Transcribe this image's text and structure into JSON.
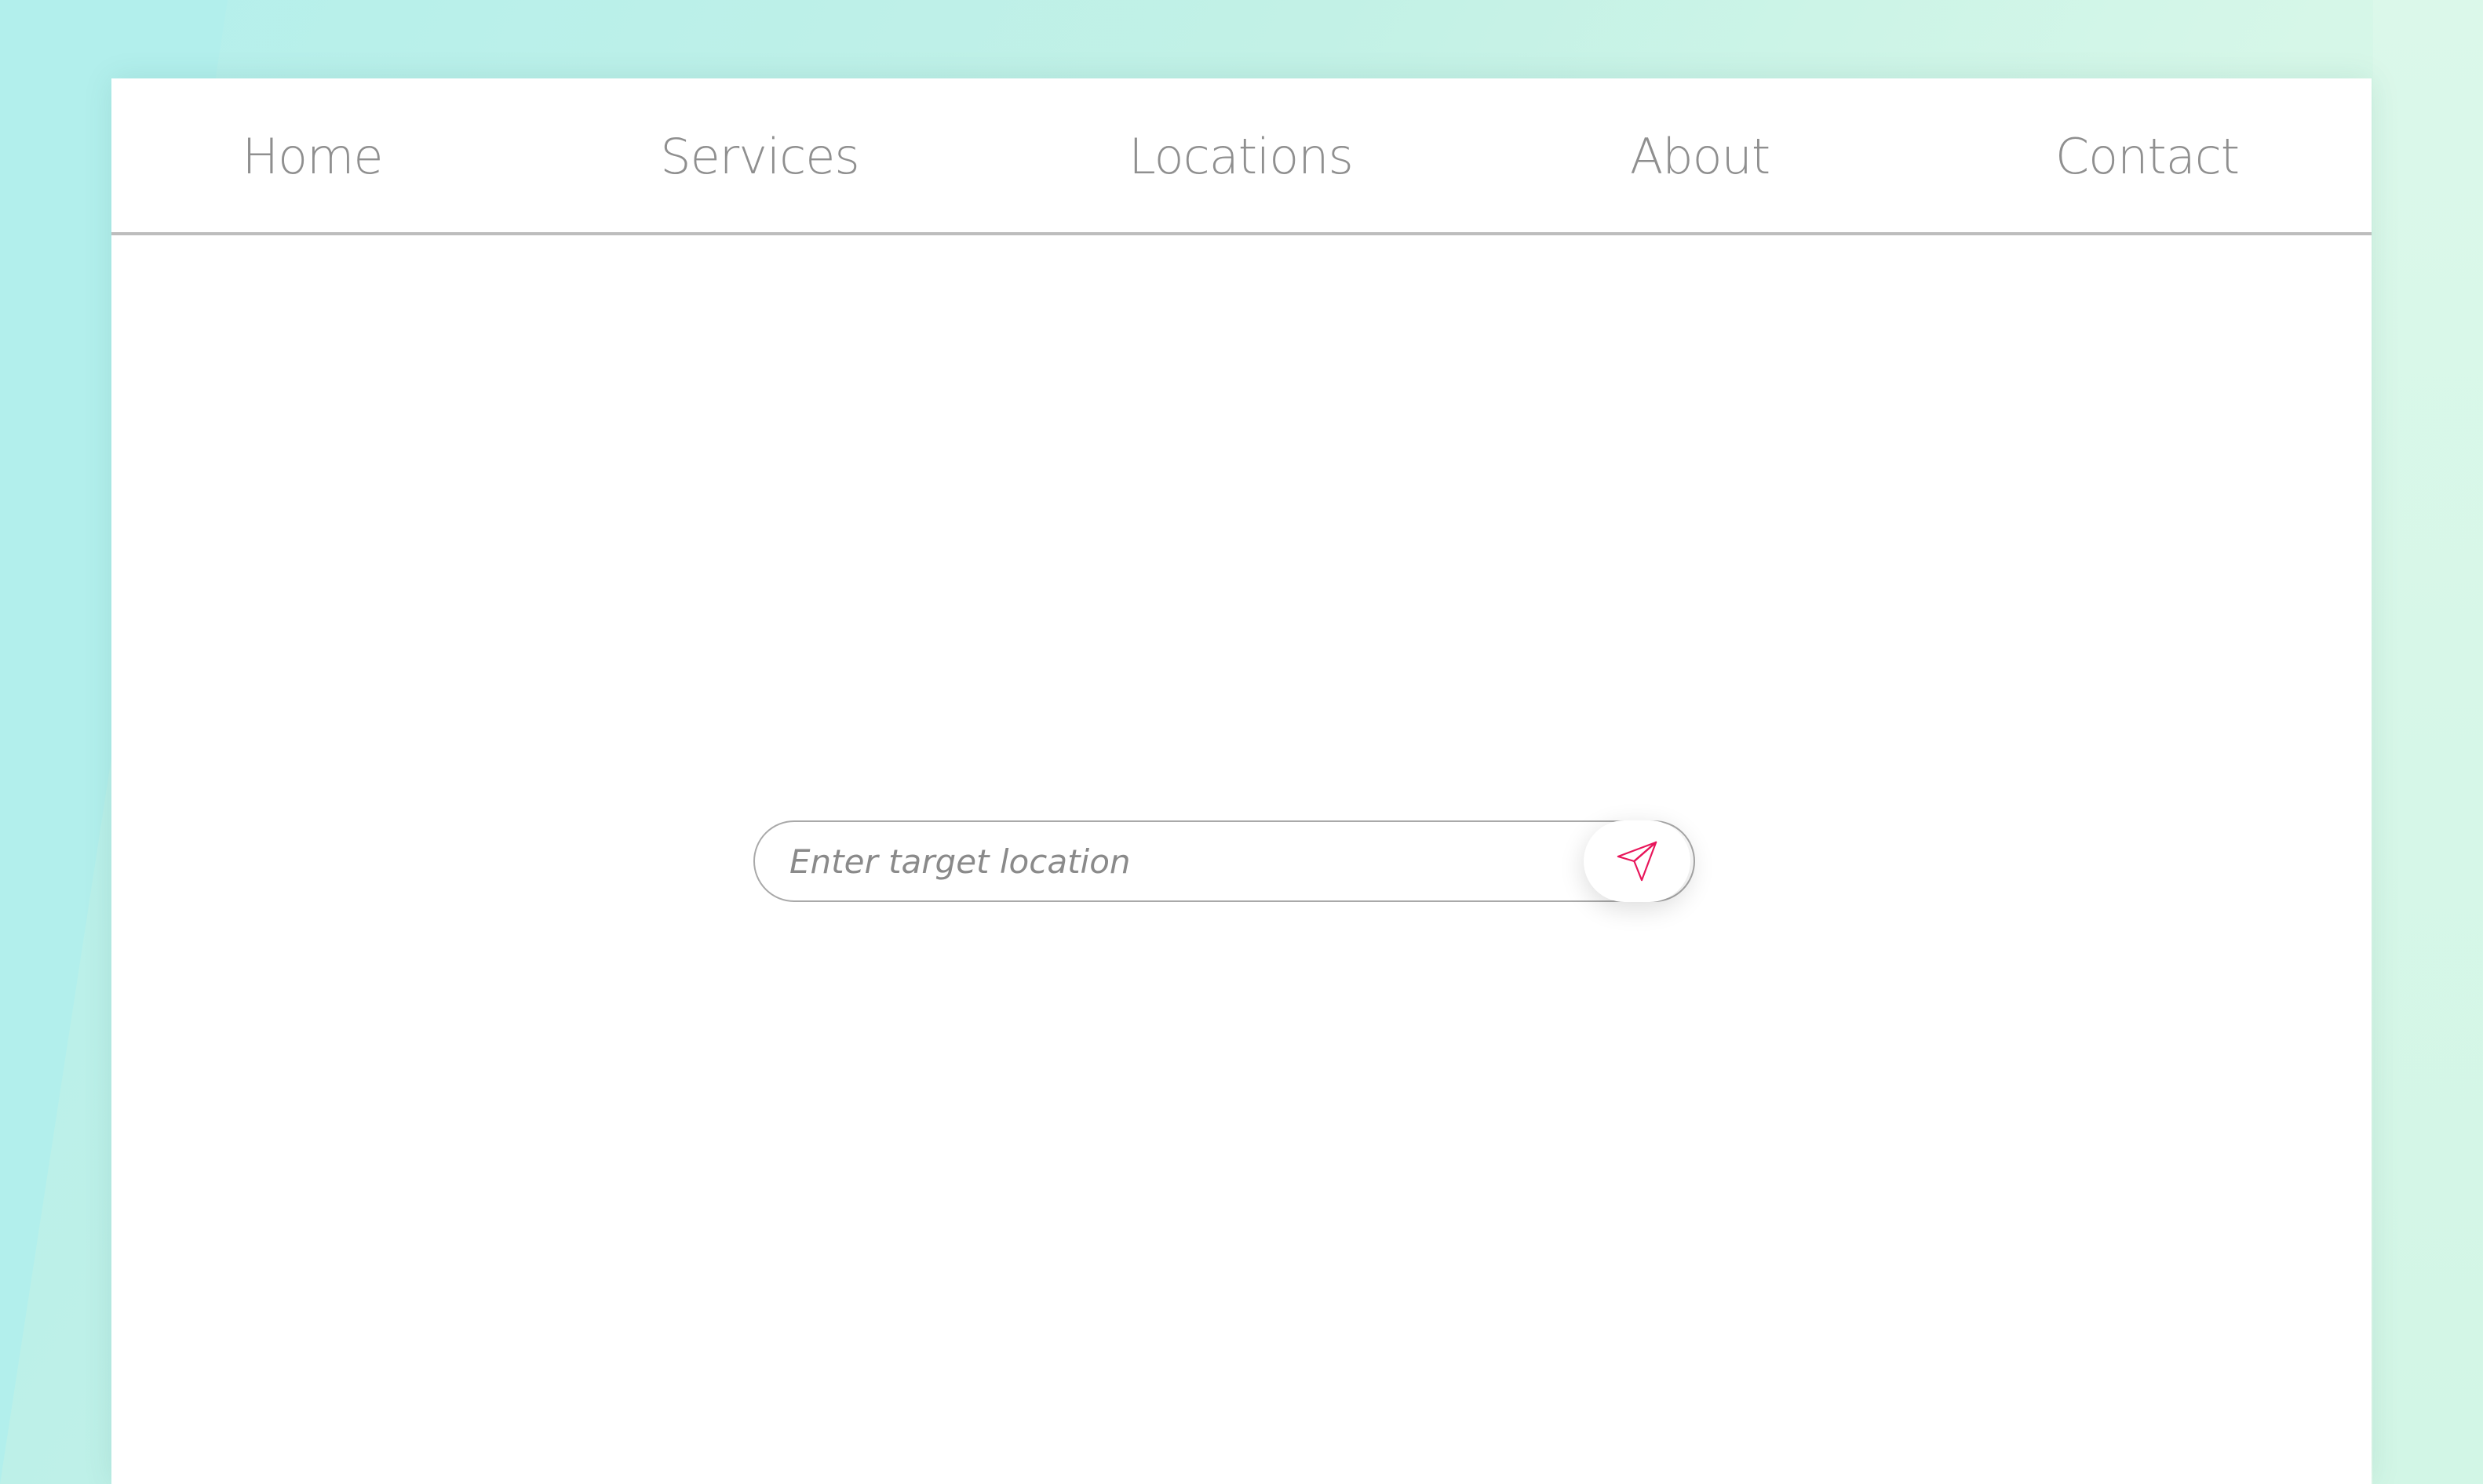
{
  "nav": {
    "items": [
      {
        "label": "Home"
      },
      {
        "label": "Services"
      },
      {
        "label": "Locations"
      },
      {
        "label": "About"
      },
      {
        "label": "Contact"
      }
    ]
  },
  "search": {
    "placeholder": "Enter target location",
    "value": "",
    "submit_icon": "paper-plane-send-icon"
  },
  "colors": {
    "accent": "#e8155a",
    "nav_text": "#8f8f8f",
    "background": "#c2f1e6",
    "card": "#ffffff",
    "divider": "#bdbdbd"
  }
}
